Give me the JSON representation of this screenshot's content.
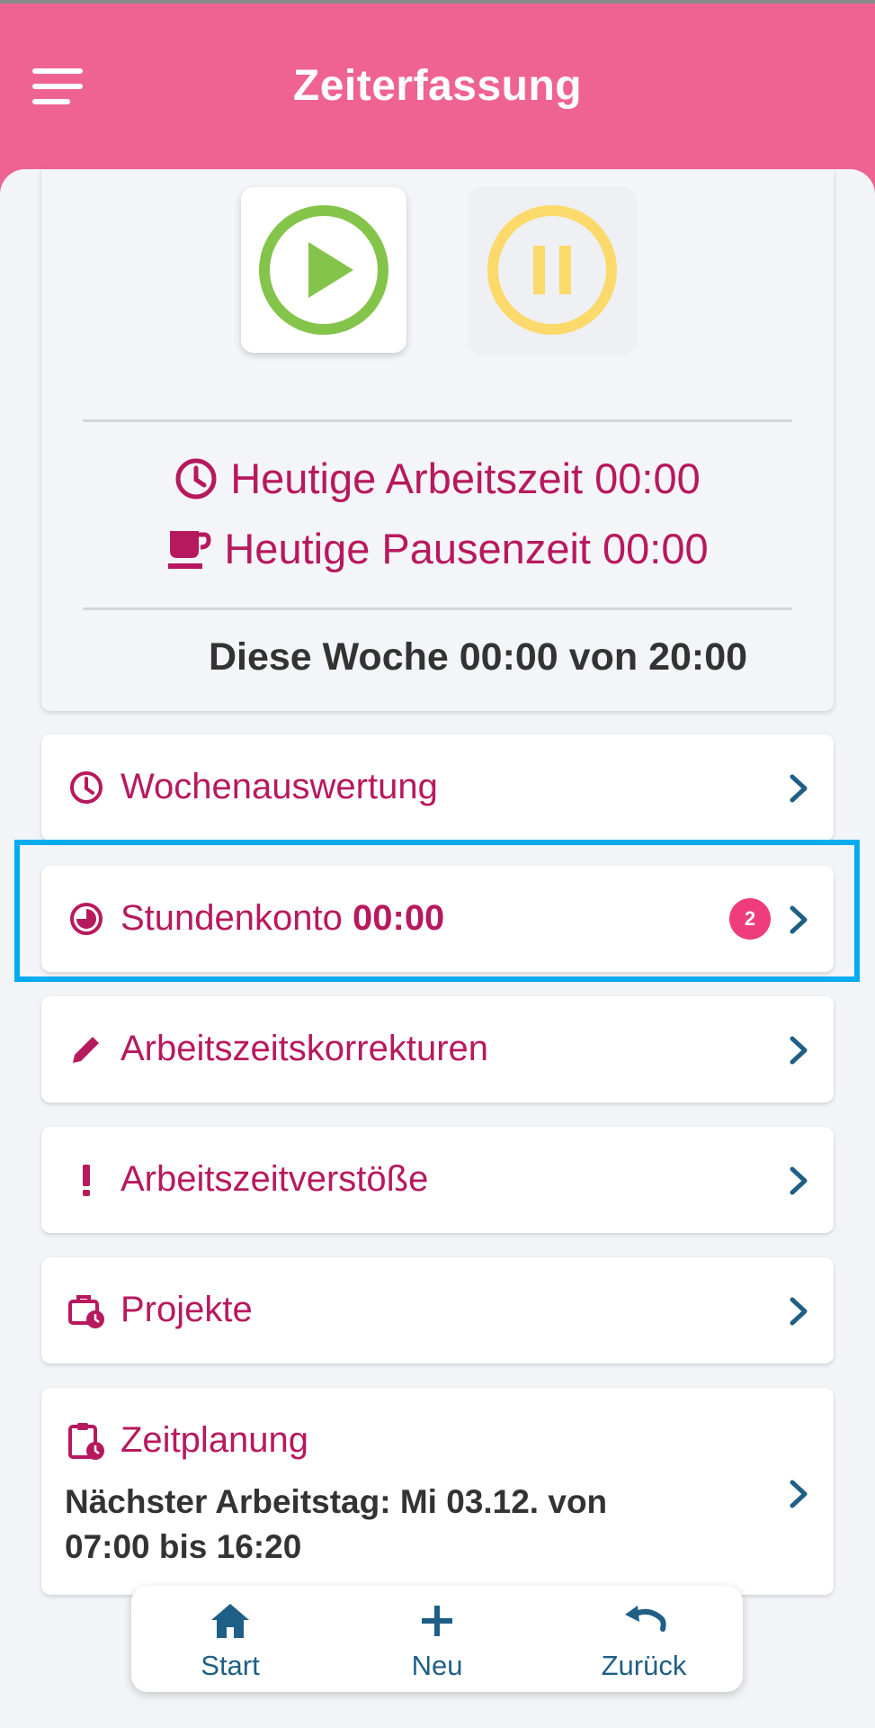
{
  "app": {
    "title": "Zeiterfassung",
    "accent": "#ef6393",
    "text_accent": "#b7195e"
  },
  "summary": {
    "work_time_label": "Heutige Arbeitszeit 00:00",
    "break_time_label": "Heutige Pausenzeit 00:00",
    "week_label": "Diese Woche 00:00 von 20:00"
  },
  "menu": {
    "wochenauswertung": {
      "label": "Wochenauswertung"
    },
    "stundenkonto": {
      "label": "Stundenkonto",
      "value": "00:00",
      "badge": "2"
    },
    "korrekturen": {
      "label": "Arbeitszeitskorrekturen"
    },
    "verstoesse": {
      "label": "Arbeitszeitverstöße"
    },
    "projekte": {
      "label": "Projekte"
    },
    "zeitplanung": {
      "label": "Zeitplanung",
      "line1": "Nächster Arbeitstag: Mi 03.12. von",
      "line2": "07:00 bis 16:20"
    }
  },
  "nav": {
    "start": "Start",
    "neu": "Neu",
    "zurueck": "Zurück"
  },
  "icons": {
    "menu": "hamburger-icon",
    "play": "play-icon",
    "pause": "pause-icon",
    "clock": "clock-icon",
    "coffee": "coffee-icon",
    "pie": "pie-icon",
    "pencil": "pencil-icon",
    "exclamation": "exclamation-icon",
    "briefcase": "briefcase-clock-icon",
    "clipboard": "clipboard-clock-icon",
    "home": "home-icon",
    "plus": "plus-icon",
    "undo": "undo-icon"
  }
}
